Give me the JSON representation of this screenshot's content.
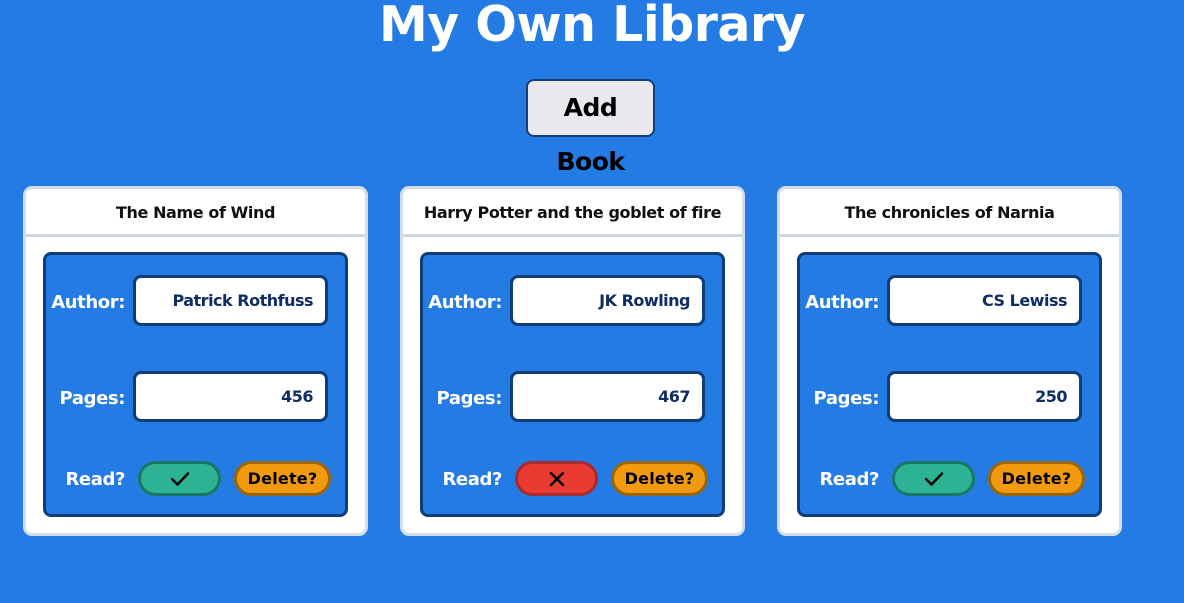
{
  "page": {
    "title": "My Own Library",
    "add_button_label": "Add Book"
  },
  "labels": {
    "author": "Author:",
    "pages": "Pages:",
    "read": "Read?",
    "delete": "Delete?"
  },
  "colors": {
    "background": "#247be3",
    "read_on": "#2db294",
    "read_off": "#ea3b32",
    "delete": "#f19a0f"
  },
  "books": [
    {
      "title": "The Name of Wind",
      "author": "Patrick Rothfuss",
      "pages": "456",
      "read": true,
      "read_icon": "check-icon"
    },
    {
      "title": "Harry Potter and the goblet of fire",
      "author": "JK Rowling",
      "pages": "467",
      "read": false,
      "read_icon": "x-icon"
    },
    {
      "title": "The chronicles of Narnia",
      "author": "CS Lewiss",
      "pages": "250",
      "read": true,
      "read_icon": "check-icon"
    }
  ]
}
